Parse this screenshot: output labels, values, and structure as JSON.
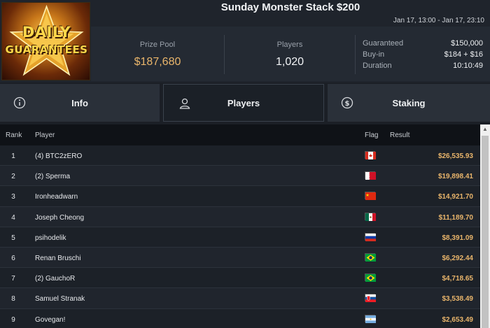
{
  "logo": {
    "line1": "DAILY",
    "line2": "GUARANTEES"
  },
  "title": "Sunday Monster Stack $200",
  "dates": "Jan 17, 13:00 - Jan 17, 23:10",
  "stats": {
    "prize_label": "Prize Pool",
    "prize_value": "$187,680",
    "players_label": "Players",
    "players_value": "1,020"
  },
  "details": [
    {
      "k": "Guaranteed",
      "v": "$150,000"
    },
    {
      "k": "Buy-in",
      "v": "$184 + $16"
    },
    {
      "k": "Duration",
      "v": "10:10:49"
    }
  ],
  "tabs": {
    "info": "Info",
    "players": "Players",
    "staking": "Staking",
    "selected": "players"
  },
  "table": {
    "headers": {
      "rank": "Rank",
      "player": "Player",
      "flag": "Flag",
      "result": "Result"
    },
    "rows": [
      {
        "rank": "1",
        "player": "(4) BTC2zERO",
        "flag": "canada",
        "result": "$26,535.93"
      },
      {
        "rank": "2",
        "player": "(2) Sperma",
        "flag": "bahrain",
        "result": "$19,898.41"
      },
      {
        "rank": "3",
        "player": "Ironheadwarn",
        "flag": "china",
        "result": "$14,921.70"
      },
      {
        "rank": "4",
        "player": "Joseph Cheong",
        "flag": "mexico",
        "result": "$11,189.70"
      },
      {
        "rank": "5",
        "player": "psihodelik",
        "flag": "russia",
        "result": "$8,391.09"
      },
      {
        "rank": "6",
        "player": "Renan Bruschi",
        "flag": "brazil",
        "result": "$6,292.44"
      },
      {
        "rank": "7",
        "player": "(2) GauchoR",
        "flag": "brazil",
        "result": "$4,718.65"
      },
      {
        "rank": "8",
        "player": "Samuel Stranak",
        "flag": "slovakia",
        "result": "$3,538.49"
      },
      {
        "rank": "9",
        "player": "Govegan!",
        "flag": "argentina",
        "result": "$2,653.49"
      }
    ]
  },
  "colors": {
    "accent_gold": "#e9b56b",
    "background": "#1b1f26"
  }
}
